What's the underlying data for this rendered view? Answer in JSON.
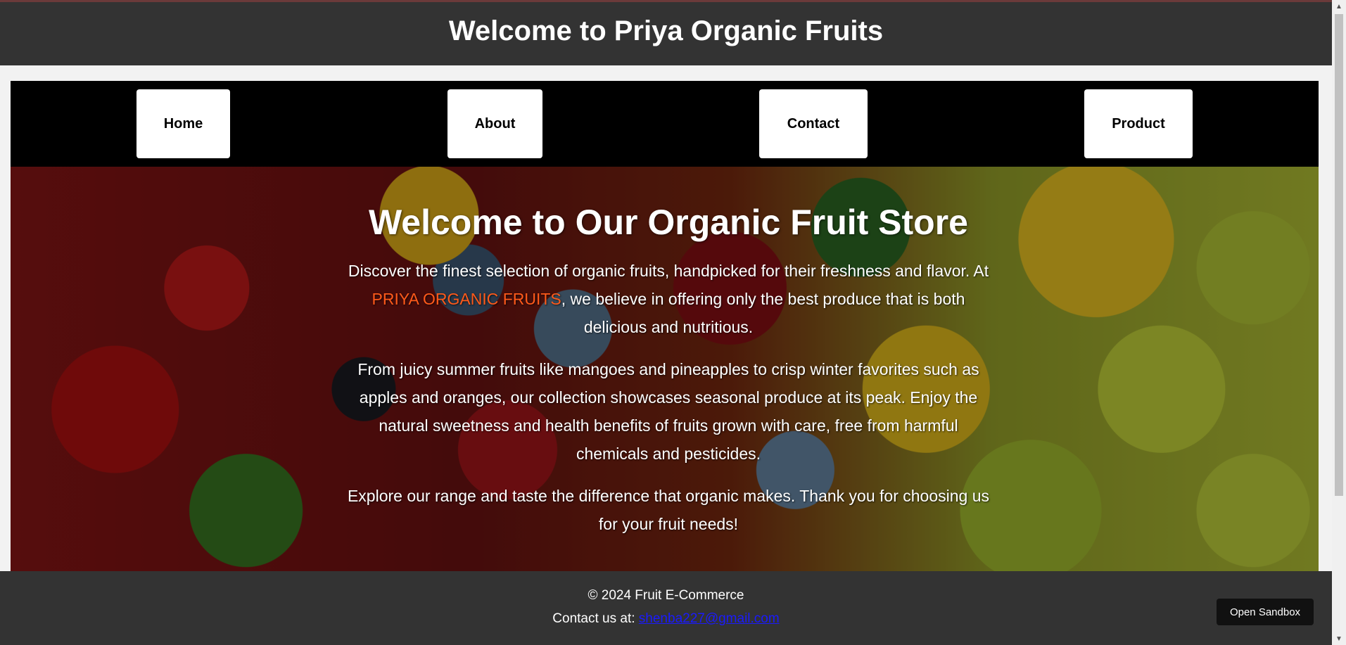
{
  "header": {
    "title": "Welcome to Priya Organic Fruits"
  },
  "nav": {
    "items": [
      {
        "label": "Home"
      },
      {
        "label": "About"
      },
      {
        "label": "Contact"
      },
      {
        "label": "Product"
      }
    ]
  },
  "hero": {
    "heading": "Welcome to Our Organic Fruit Store",
    "para1_start": "Discover the finest selection of organic fruits, handpicked for their freshness and flavor. At ",
    "brand": "PRIYA ORGANIC FRUITS",
    "para1_end": ", we believe in offering only the best produce that is both delicious and nutritious.",
    "para2": "From juicy summer fruits like mangoes and pineapples to crisp winter favorites such as apples and oranges, our collection showcases seasonal produce at its peak. Enjoy the natural sweetness and health benefits of fruits grown with care, free from harmful chemicals and pesticides.",
    "para3": "Explore our range and taste the difference that organic makes. Thank you for choosing us for your fruit needs!"
  },
  "footer": {
    "copyright": "© 2024 Fruit E-Commerce",
    "contact_label": "Contact us at: ",
    "email": "shenba227@gmail.com"
  },
  "sandbox_button": {
    "label": "Open Sandbox"
  },
  "colors": {
    "header_bg": "#333333",
    "nav_bg": "#000000",
    "brand_highlight": "#ff5a1a",
    "link": "#1a1aff"
  }
}
